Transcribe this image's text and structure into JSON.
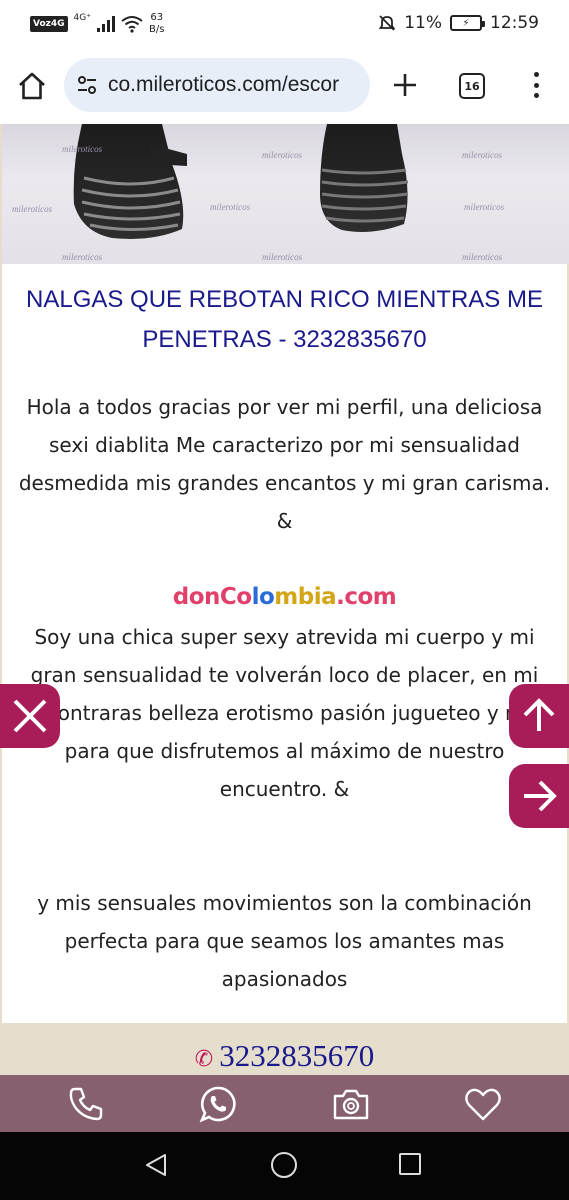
{
  "status_bar": {
    "carrier_badge": "Voz4G",
    "network": "4G⁺",
    "speed_value": "63",
    "speed_unit": "B/s",
    "battery_percent": "11%",
    "time": "12:59"
  },
  "browser": {
    "url": "co.mileroticos.com/escor",
    "tab_count": "16"
  },
  "photo": {
    "watermark": "mileroticos"
  },
  "content": {
    "title": "NALGAS QUE REBOTAN RICO MIENTRAS ME PENETRAS - 3232835670",
    "paragraph1": "Hola a todos gracias por ver mi perfil, una deliciosa sexi diablita Me caracterizo por mi sensualidad desmedida mis grandes encantos y mi gran carisma. &",
    "brand": {
      "part1": "donCo",
      "part2": "lo",
      "part3": "mbia",
      "part4": ".com"
    },
    "paragraph2": "Soy una chica super sexy atrevida mi cuerpo y mi gran sensualidad te volverán loco de placer, en mi encontraras belleza erotismo pasión jugueteo y más para que disfrutemos al máximo de nuestro encuentro. &",
    "paragraph3": "y mis sensuales movimientos son la combinación perfecta para que seamos los amantes mas apasionados",
    "phone": "3232835670"
  },
  "colors": {
    "accent": "#a81c58",
    "title": "#1a1a8c",
    "action_bar": "#86606f",
    "band": "#e6decd"
  },
  "icons": {
    "home": "home-icon",
    "site_settings": "tune-icon",
    "new_tab": "plus-icon",
    "menu": "more-vert-icon",
    "close": "close-icon",
    "scroll_up": "arrow-up-icon",
    "next": "arrow-right-icon",
    "call": "phone-icon",
    "whatsapp": "whatsapp-icon",
    "photos": "camera-icon",
    "favorite": "heart-icon"
  }
}
